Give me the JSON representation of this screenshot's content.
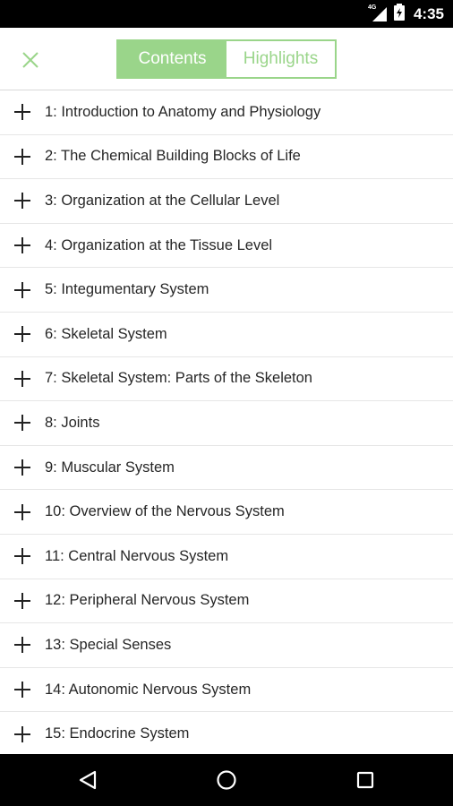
{
  "status_bar": {
    "network": "4G",
    "time": "4:35"
  },
  "toolbar": {
    "close_icon": "close-icon",
    "tabs": [
      {
        "label": "Contents",
        "active": true
      },
      {
        "label": "Highlights",
        "active": false
      }
    ]
  },
  "colors": {
    "accent": "#9ad58a",
    "text": "#262626",
    "divider": "#e6e6e6"
  },
  "chapters": [
    {
      "label": "1: Introduction to Anatomy and Physiology"
    },
    {
      "label": "2: The Chemical Building Blocks of Life"
    },
    {
      "label": "3: Organization at the Cellular Level"
    },
    {
      "label": "4: Organization at the Tissue Level"
    },
    {
      "label": "5: Integumentary System"
    },
    {
      "label": "6: Skeletal System"
    },
    {
      "label": "7: Skeletal System: Parts of the Skeleton"
    },
    {
      "label": "8: Joints"
    },
    {
      "label": "9: Muscular System"
    },
    {
      "label": "10: Overview of the Nervous System"
    },
    {
      "label": "11: Central Nervous System"
    },
    {
      "label": "12: Peripheral Nervous System"
    },
    {
      "label": "13: Special Senses"
    },
    {
      "label": "14: Autonomic Nervous System"
    },
    {
      "label": "15: Endocrine System"
    }
  ]
}
